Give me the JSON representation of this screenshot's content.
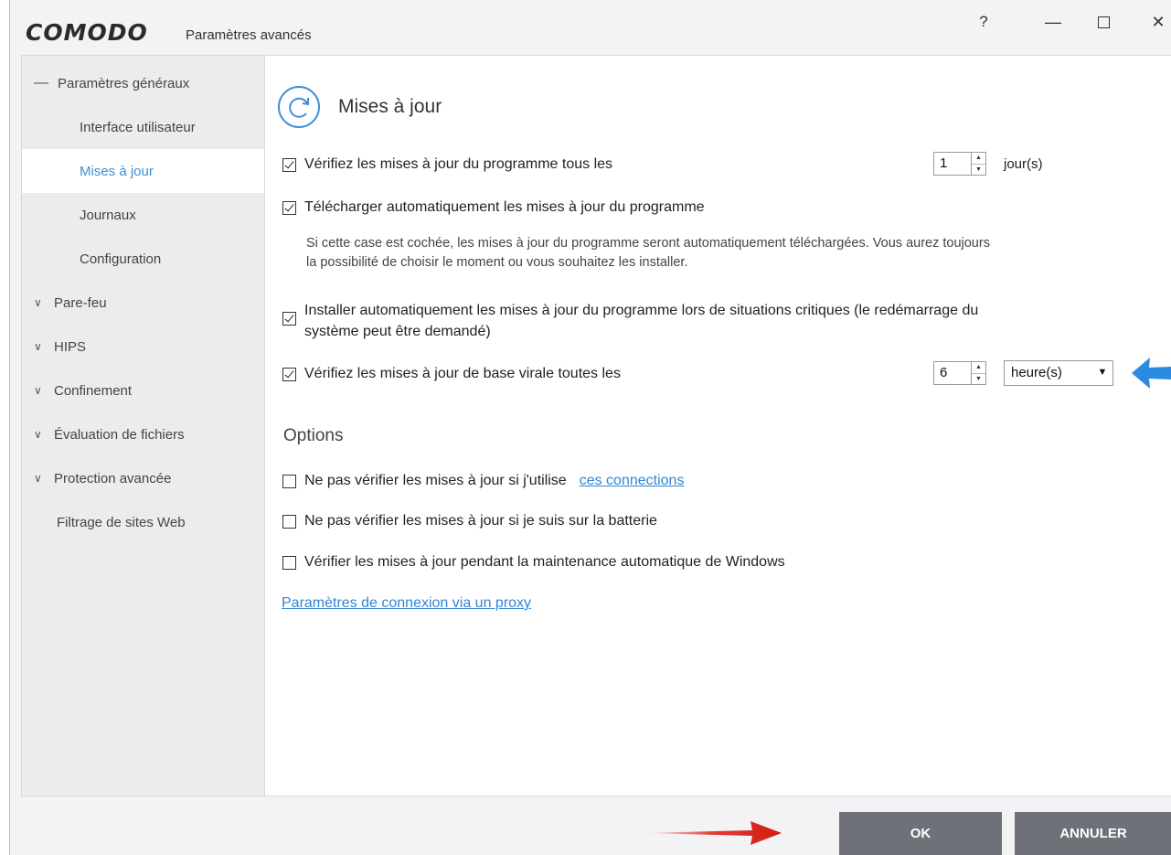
{
  "window": {
    "logo": "COMODO",
    "title": "Paramètres avancés",
    "controls": {
      "help": "?",
      "minimize": "—",
      "close": "✕"
    }
  },
  "sidebar": {
    "groups": [
      {
        "label": "Paramètres généraux",
        "expanded": true
      },
      {
        "label": "Interface utilisateur"
      },
      {
        "label": "Mises à jour",
        "selected": true
      },
      {
        "label": "Journaux"
      },
      {
        "label": "Configuration"
      },
      {
        "label": "Pare-feu",
        "expanded": false
      },
      {
        "label": "HIPS",
        "expanded": false
      },
      {
        "label": "Confinement",
        "expanded": false
      },
      {
        "label": "Évaluation de fichiers",
        "expanded": false
      },
      {
        "label": "Protection avancée",
        "expanded": false
      },
      {
        "label": "Filtrage de sites Web"
      }
    ]
  },
  "main": {
    "title": "Mises à jour",
    "settings": {
      "check_program": {
        "label": "Vérifiez les mises à jour du programme tous les",
        "checked": true,
        "value": "1",
        "unit": "jour(s)"
      },
      "auto_download": {
        "label": "Télécharger automatiquement les mises à jour du programme",
        "checked": true
      },
      "auto_download_desc_1": "Si cette case est cochée, les mises à jour du programme seront automatiquement téléchargées. Vous aurez toujours",
      "auto_download_desc_2": "la possibilité de choisir le moment ou vous souhaitez les installer.",
      "auto_install": {
        "label_1": "Installer automatiquement les mises à jour du programme lors de situations critiques (le redémarrage du",
        "label_2": "système peut être demandé)",
        "checked": true
      },
      "check_virus_db": {
        "label": "Vérifiez les mises à jour de base virale toutes les",
        "checked": true,
        "value": "6",
        "unit_selected": "heure(s)"
      }
    },
    "options": {
      "title": "Options",
      "no_check_connections": {
        "label": "Ne pas vérifier les mises à jour si j'utilise",
        "link": "ces connections",
        "checked": false
      },
      "no_check_battery": {
        "label": "Ne pas vérifier les mises à jour si je suis sur la batterie",
        "checked": false
      },
      "check_maintenance": {
        "label": "Vérifier les mises à jour pendant la maintenance automatique de Windows",
        "checked": false
      },
      "proxy_link": "Paramètres de connexion via un proxy"
    }
  },
  "footer": {
    "ok_label": "OK",
    "cancel_label": "ANNULER"
  },
  "colors": {
    "accent": "#3d8fd8",
    "button": "#6e7178",
    "annotation_red": "#e0281e",
    "annotation_blue": "#2a8be0"
  }
}
